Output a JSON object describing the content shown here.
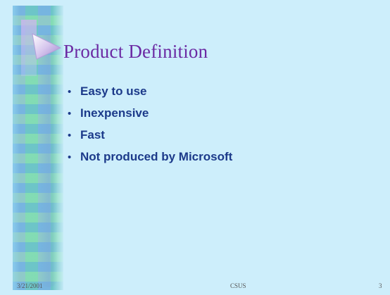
{
  "slide": {
    "title": "Product Definition",
    "bullets": [
      "Easy to use",
      "Inexpensive",
      "Fast",
      "Not produced by Microsoft"
    ],
    "footer": {
      "date": "3/21/2001",
      "center": "CSUS",
      "page_number": "3"
    },
    "colors": {
      "background": "#cdeefb",
      "title": "#6b2aa3",
      "bullet_text": "#1c3a8a"
    },
    "decorations": {
      "arrow_icon": "triangle-arrow-icon"
    }
  }
}
